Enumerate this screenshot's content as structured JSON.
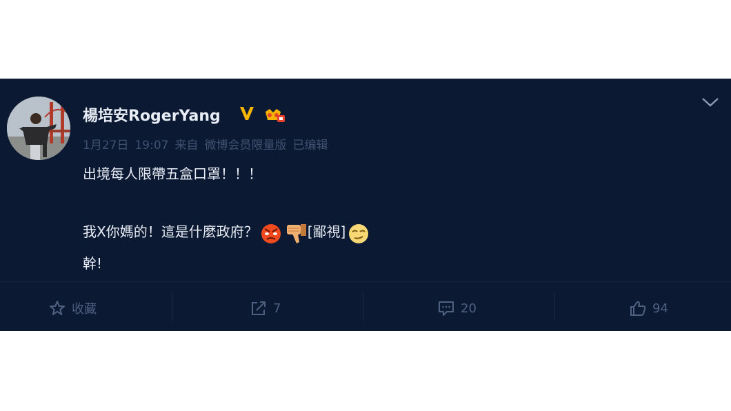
{
  "post": {
    "username": "楊培安RogerYang",
    "meta": {
      "date": "1月27日",
      "time": "19:07",
      "source_prefix": "来自",
      "source": "微博会员限量版",
      "edited": "已编辑"
    },
    "content": {
      "line1": "出境每人限帶五盒口罩！！！",
      "line2_text": "我X你媽的！這是什麼政府？",
      "line2_tag": "[鄙視]",
      "line3": "幹!"
    },
    "icons": [
      "v-verified-icon",
      "vip-crown-icon",
      "chevron-down-icon",
      "star-icon",
      "share-icon",
      "comment-icon",
      "thumb-up-icon",
      "angry-emoji",
      "thumb-down-emoji",
      "smirk-emoji"
    ]
  },
  "actions": {
    "favorite_label": "收藏",
    "repost_count": "7",
    "comment_count": "20",
    "like_count": "94"
  },
  "colors": {
    "background": "#0b1933",
    "text": "#e8edf5",
    "meta": "#3f5170",
    "action": "#4f6180",
    "accent_gold": "#f5b400"
  }
}
